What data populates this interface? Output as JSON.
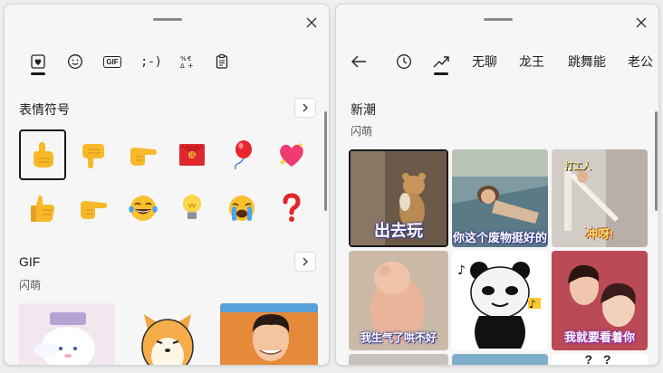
{
  "left": {
    "section_emoji": "表情符号",
    "section_gif": "GIF",
    "gif_sub": "闪萌",
    "tabs": [
      "emoji-favorites-icon",
      "smiley-icon",
      "gif-icon",
      "kaomoji-icon",
      "symbols-icon",
      "clipboard-icon"
    ],
    "tab_labels": {
      "gif": "GIF",
      "kaomoji": ";-)"
    },
    "emojis": [
      "pointing-up-hand",
      "pointing-down-hand",
      "pointing-right-hand",
      "red-envelope",
      "red-balloon",
      "sparkling-heart",
      "thumbs-up",
      "pointing-right-hand-2",
      "tears-of-joy-face",
      "light-bulb",
      "crying-face",
      "question-mark"
    ]
  },
  "right": {
    "tabs": [
      "无聊",
      "龙王",
      "跳舞能",
      "老公"
    ],
    "section_title": "新潮",
    "section_sub": "闪萌",
    "gifs": [
      {
        "caption": "出去玩"
      },
      {
        "caption": "你这个废物挺好的"
      },
      {
        "caption": "冲呀!",
        "top_label": "打工人"
      },
      {
        "caption": "我生气了哄不好"
      },
      {
        "caption": ""
      },
      {
        "caption": "我就要看着你"
      }
    ],
    "partial_gif_text": "? ?"
  },
  "colors": {
    "accent": "#1a1a1a",
    "panel": "#f6f6f6"
  }
}
